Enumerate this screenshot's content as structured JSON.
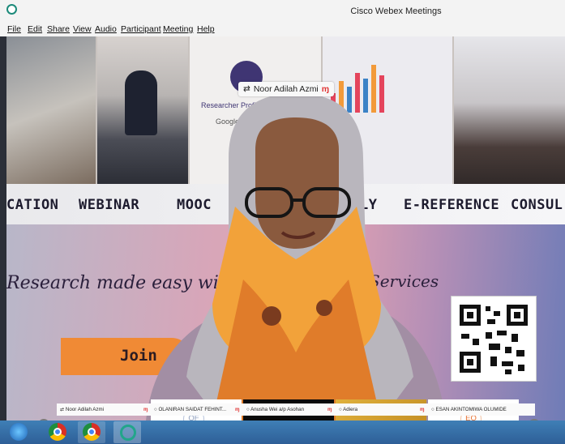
{
  "window": {
    "title": "Cisco Webex Meetings"
  },
  "menu": [
    "File",
    "Edit",
    "Share",
    "View",
    "Audio",
    "Participant",
    "Meeting",
    "Help"
  ],
  "share_indicator": {
    "name": "Noor Adilah Azmi"
  },
  "shared_content": {
    "researcher_label": "Researcher Profile",
    "google_label": "Google Scho",
    "banner_items": [
      "CATION",
      "WEBINAR",
      "MOOC",
      "LY",
      "E-REFERENCE",
      "CONSUL"
    ],
    "tagline_left": "Research made easy wi",
    "tagline_right": "Services",
    "join_text": "Join"
  },
  "thumbnails": [
    {
      "initials": "OF",
      "name": "OLANIRAN SAIDAT FEHINT..."
    },
    {
      "initials": "",
      "name": "Anusha Wei a/p Asohan"
    },
    {
      "initials": "",
      "name": "Adiera"
    },
    {
      "initials": "EO",
      "name": "ESAN AKINTOMIWA OLUMIDE"
    }
  ],
  "self_name": "Noor Adilah Azmi",
  "colors": {
    "accent": "#f08a35",
    "taskbar": "#2e5f97",
    "mute": "#e03535"
  },
  "icons": {
    "app": "webex-icon",
    "chrome": "chrome-icon",
    "webex_task": "webex-icon"
  }
}
